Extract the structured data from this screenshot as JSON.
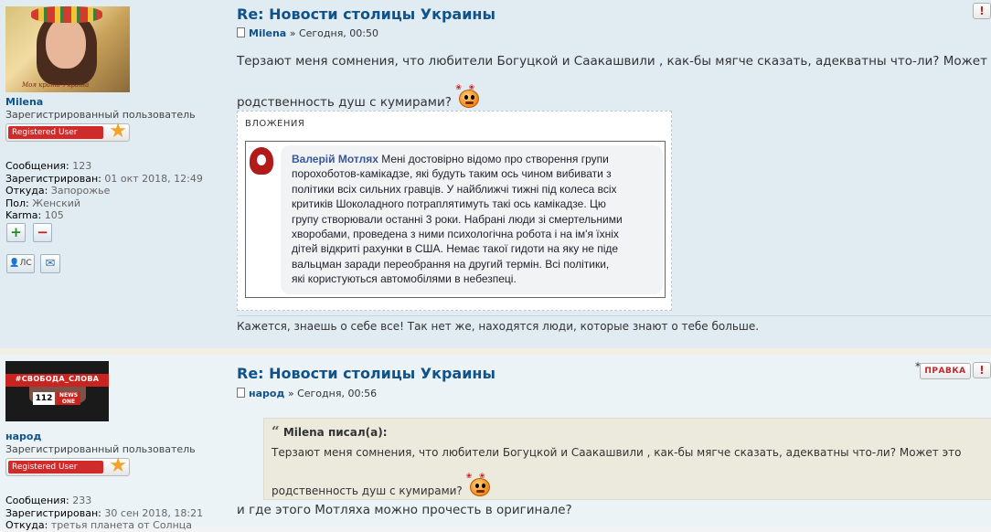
{
  "posts": [
    {
      "author": {
        "name": "Milena",
        "rank": "Зарегистрированный пользователь",
        "badge": "Registered User",
        "avatar_caption": "Моя країна Україна",
        "stats": [
          {
            "label": "Сообщения:",
            "value": "123"
          },
          {
            "label": "Зарегистрирован:",
            "value": "01 окт 2018, 12:49"
          },
          {
            "label": "Откуда:",
            "value": "Запорожье"
          },
          {
            "label": "Пол:",
            "value": "Женский"
          },
          {
            "label": "Karma:",
            "value": "105"
          }
        ],
        "pm_label": "ЛС"
      },
      "title": "Re: Новости столицы Украины",
      "author_line": {
        "name": "Milena",
        "sep": "»",
        "time": "Сегодня, 00:50"
      },
      "body_line1": "Терзают меня сомнения, что любители Богуцкой и Саакашвили , как-бы мягче сказать, адекватны что-ли? Может это",
      "body_line2": "родственность душ с кумирами?",
      "attachment": {
        "label": "ВЛОЖЕНИЯ",
        "fb_name": "Валерій Мотлях",
        "fb_lines": [
          "Мені достовірно відомо про створення групи",
          "порохоботов-камікадзе, які будуть таким ось чином вибивати з",
          "політики всіх сильних гравців. У найближчі тижні під колеса всіх",
          "критиків Шоколадного потраплятимуть такі ось камікадзе. Цю",
          "групу створювали останні 3 роки. Набрані люди зі смертельними",
          "хворобами, проведена з ними психологічна робота і на ім'я їхніх",
          "дітей відкриті рахунки в США. Немає такої гидоти на яку не піде",
          "вальцман заради переобрання на другий термін. Всі політики,",
          "які користуються автомобілями в небезпеці."
        ]
      },
      "signature": "Кажется, знаешь о себе все! Так нет же, находятся люди, которые знают о тебе больше.",
      "report_icon": "!"
    },
    {
      "author": {
        "name": "народ",
        "rank": "Зарегистрированный пользователь",
        "badge": "Registered User",
        "avatar_tape": "#СВОБОДА_СЛОВА",
        "avatar_logo1": "112",
        "avatar_logo2": "NEWS ONE",
        "stats": [
          {
            "label": "Сообщения:",
            "value": "233"
          },
          {
            "label": "Зарегистрирован:",
            "value": "30 сен 2018, 18:21"
          },
          {
            "label": "Откуда:",
            "value": "третья планета от Солнца"
          }
        ]
      },
      "title": "Re: Новости столицы Украины",
      "author_line": {
        "name": "народ",
        "sep": "»",
        "time": "Сегодня, 00:56"
      },
      "quote": {
        "author": "Milena",
        "wrote": "писал(а):",
        "line1": "Терзают меня сомнения, что любители Богуцкой и Саакашвили , как-бы мягче сказать, адекватны что-ли? Может это",
        "line2": "родственность душ с кумирами?"
      },
      "body": "и где этого Мотляха можно прочесть в оригинале?",
      "edit_label": "ПРАВКА",
      "report_icon": "!"
    }
  ],
  "icons": {
    "post_icon": "document-icon",
    "smiley": "smiley-icon",
    "report": "warning-icon",
    "edit": "edit-icon",
    "karma_plus": "plus-icon",
    "karma_minus": "minus-icon",
    "pm": "user-pm-icon",
    "email": "envelope-icon"
  },
  "colors": {
    "post_bg1": "#e1ebf2",
    "post_bg2": "#ecf3f7",
    "link": "#105289",
    "badge_red": "#cf2b2b",
    "quote_bg": "#ebeadd"
  }
}
